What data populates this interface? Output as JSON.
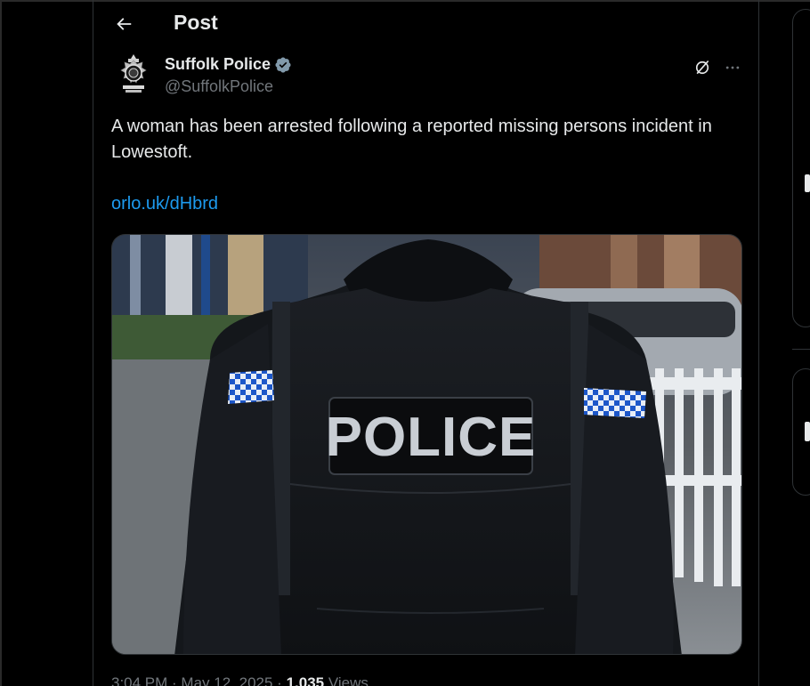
{
  "header": {
    "title": "Post"
  },
  "post": {
    "author": {
      "display_name": "Suffolk Police",
      "handle": "@SuffolkPolice",
      "verified": true
    },
    "text": "A woman has been arrested following a reported missing persons incident in Lowestoft.",
    "link": "orlo.uk/dHbrd",
    "image": {
      "vest_text": "POLICE"
    },
    "meta": {
      "time_date": "3:04 PM · May 12, 2025 ·",
      "views_count": "1,035",
      "views_label": "Views"
    }
  },
  "icons": {
    "back": "arrow-left-icon",
    "verified": "verified-badge-icon",
    "grok": "grok-icon",
    "more": "more-horizontal-icon"
  },
  "colors": {
    "background": "#000000",
    "text_primary": "#e7e9ea",
    "text_secondary": "#71767b",
    "link": "#1d9bf0",
    "border": "#2f3336",
    "verified": "#829aab"
  }
}
